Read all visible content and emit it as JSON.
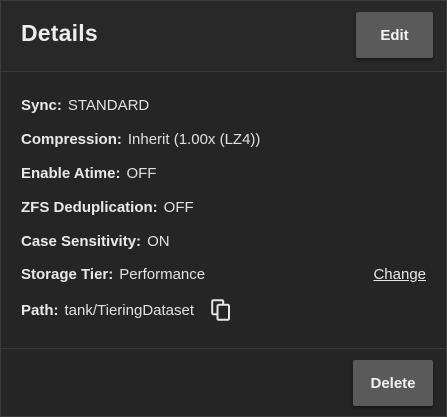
{
  "header": {
    "title": "Details",
    "edit_label": "Edit"
  },
  "details": [
    {
      "label": "Sync:",
      "value": "STANDARD"
    },
    {
      "label": "Compression:",
      "value": "Inherit (1.00x (LZ4))"
    },
    {
      "label": "Enable Atime:",
      "value": "OFF"
    },
    {
      "label": "ZFS Deduplication:",
      "value": "OFF"
    },
    {
      "label": "Case Sensitivity:",
      "value": "ON"
    },
    {
      "label": "Storage Tier:",
      "value": "Performance",
      "action": "Change"
    },
    {
      "label": "Path:",
      "value": "tank/TieringDataset",
      "icon": "copy-icon"
    }
  ],
  "actions": {
    "delete_label": "Delete"
  }
}
